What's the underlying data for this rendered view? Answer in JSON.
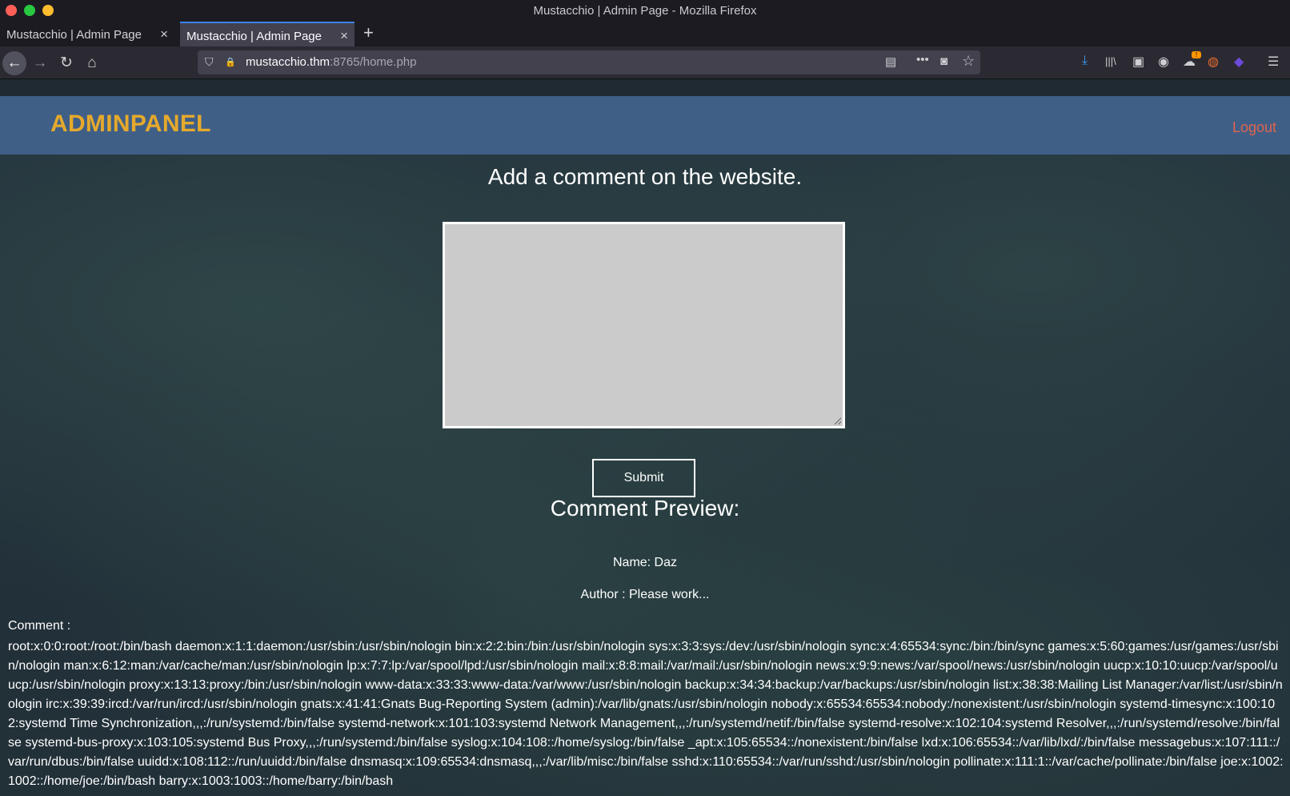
{
  "window": {
    "title": "Mustacchio | Admin Page - Mozilla Firefox"
  },
  "tabs": [
    {
      "label": "Mustacchio | Admin Page",
      "active": false
    },
    {
      "label": "Mustacchio | Admin Page",
      "active": true
    }
  ],
  "url": {
    "host": "mustacchio.thm",
    "rest": ":8765/home.php"
  },
  "icons": {
    "close": "×",
    "new_tab": "+",
    "back": "←",
    "forward": "→",
    "reload": "↻",
    "home": "⌂",
    "shield": "⛉",
    "lock_slash": "🔒",
    "reader": "▤",
    "more": "•••",
    "pocket": "◙",
    "star": "☆",
    "download": "⤓",
    "library": "|||\\",
    "sidebar": "▣",
    "account": "◉",
    "ext1": "☁",
    "ext2": "◍",
    "ext3": "◆",
    "menu": "☰"
  },
  "extension_badge": "!",
  "page": {
    "brand": "ADMINPANEL",
    "logout": "Logout",
    "heading": "Add a comment on the website.",
    "textarea_value": "",
    "submit": "Submit",
    "preview_title": "Comment Preview:",
    "name_line": "Name: Daz",
    "author_line": "Author : Please work...",
    "comment_label": "Comment :",
    "comment_body": "root:x:0:0:root:/root:/bin/bash daemon:x:1:1:daemon:/usr/sbin:/usr/sbin/nologin bin:x:2:2:bin:/bin:/usr/sbin/nologin sys:x:3:3:sys:/dev:/usr/sbin/nologin sync:x:4:65534:sync:/bin:/bin/sync games:x:5:60:games:/usr/games:/usr/sbin/nologin man:x:6:12:man:/var/cache/man:/usr/sbin/nologin lp:x:7:7:lp:/var/spool/lpd:/usr/sbin/nologin mail:x:8:8:mail:/var/mail:/usr/sbin/nologin news:x:9:9:news:/var/spool/news:/usr/sbin/nologin uucp:x:10:10:uucp:/var/spool/uucp:/usr/sbin/nologin proxy:x:13:13:proxy:/bin:/usr/sbin/nologin www-data:x:33:33:www-data:/var/www:/usr/sbin/nologin backup:x:34:34:backup:/var/backups:/usr/sbin/nologin list:x:38:38:Mailing List Manager:/var/list:/usr/sbin/nologin irc:x:39:39:ircd:/var/run/ircd:/usr/sbin/nologin gnats:x:41:41:Gnats Bug-Reporting System (admin):/var/lib/gnats:/usr/sbin/nologin nobody:x:65534:65534:nobody:/nonexistent:/usr/sbin/nologin systemd-timesync:x:100:102:systemd Time Synchronization,,,:/run/systemd:/bin/false systemd-network:x:101:103:systemd Network Management,,,:/run/systemd/netif:/bin/false systemd-resolve:x:102:104:systemd Resolver,,,:/run/systemd/resolve:/bin/false systemd-bus-proxy:x:103:105:systemd Bus Proxy,,,:/run/systemd:/bin/false syslog:x:104:108::/home/syslog:/bin/false _apt:x:105:65534::/nonexistent:/bin/false lxd:x:106:65534::/var/lib/lxd/:/bin/false messagebus:x:107:111::/var/run/dbus:/bin/false uuidd:x:108:112::/run/uuidd:/bin/false dnsmasq:x:109:65534:dnsmasq,,,:/var/lib/misc:/bin/false sshd:x:110:65534::/var/run/sshd:/usr/sbin/nologin pollinate:x:111:1::/var/cache/pollinate:/bin/false joe:x:1002:1002::/home/joe:/bin/bash barry:x:1003:1003::/home/barry:/bin/bash"
  }
}
